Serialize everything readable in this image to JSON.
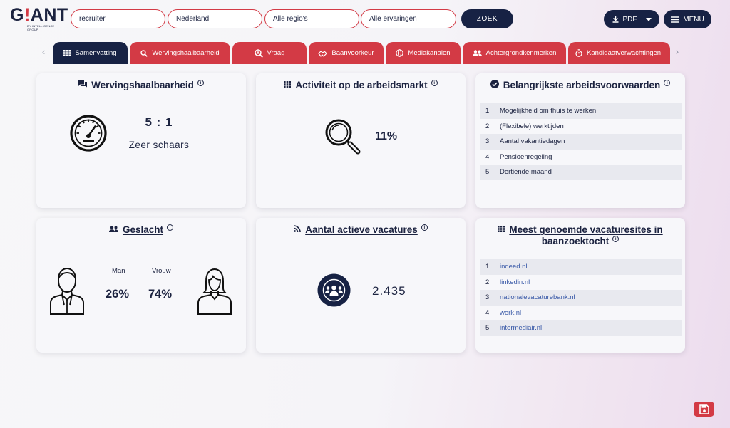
{
  "logo": {
    "text_prefix": "G",
    "text_accent": "!",
    "text_suffix": "ANT",
    "subtitle": "BY INTELLIGENCE GROUP"
  },
  "search": {
    "job_value": "recruiter",
    "country_value": "Nederland",
    "region_value": "Alle regio's",
    "experience_value": "Alle ervaringen",
    "submit_label": "ZOEK"
  },
  "toolbar": {
    "pdf_label": "PDF",
    "menu_label": "MENU"
  },
  "tabs": [
    {
      "label": "Samenvatting",
      "icon": "grid-icon",
      "active": true
    },
    {
      "label": "Wervingshaalbaarheid",
      "icon": "search-icon",
      "active": false
    },
    {
      "label": "Vraag",
      "icon": "search-plus-icon",
      "active": false
    },
    {
      "label": "Baanvoorkeur",
      "icon": "handshake-icon",
      "active": false
    },
    {
      "label": "Mediakanalen",
      "icon": "globe-icon",
      "active": false
    },
    {
      "label": "Achtergrondkenmerken",
      "icon": "people-icon",
      "active": false
    },
    {
      "label": "Kandidaatverwachtingen",
      "icon": "stopwatch-icon",
      "active": false
    }
  ],
  "cards": {
    "recruitability": {
      "title": "Wervingshaalbaarheid",
      "ratio": "5 : 1",
      "label": "Zeer schaars"
    },
    "activity": {
      "title": "Activiteit op de arbeidsmarkt",
      "value": "11%"
    },
    "conditions": {
      "title": "Belangrijkste arbeidsvoorwaarden",
      "items": [
        {
          "rank": "1",
          "label": "Mogelijkheid om thuis te werken"
        },
        {
          "rank": "2",
          "label": "(Flexibele) werktijden"
        },
        {
          "rank": "3",
          "label": "Aantal vakantiedagen"
        },
        {
          "rank": "4",
          "label": "Pensioenregeling"
        },
        {
          "rank": "5",
          "label": "Dertiende maand"
        }
      ]
    },
    "gender": {
      "title": "Geslacht",
      "male_label": "Man",
      "female_label": "Vrouw",
      "male_value": "26%",
      "female_value": "74%"
    },
    "vacancies": {
      "title": "Aantal actieve vacatures",
      "value": "2.435"
    },
    "sites": {
      "title_line1": "Meest genoemde vacaturesites in",
      "title_line2": "baanzoektocht",
      "items": [
        {
          "rank": "1",
          "label": "indeed.nl"
        },
        {
          "rank": "2",
          "label": "linkedin.nl"
        },
        {
          "rank": "3",
          "label": "nationalevacaturebank.nl"
        },
        {
          "rank": "4",
          "label": "werk.nl"
        },
        {
          "rank": "5",
          "label": "intermediair.nl"
        }
      ]
    }
  },
  "colors": {
    "brand_red": "#d33a45",
    "navy": "#172244",
    "link_blue": "#3a5aa8"
  }
}
